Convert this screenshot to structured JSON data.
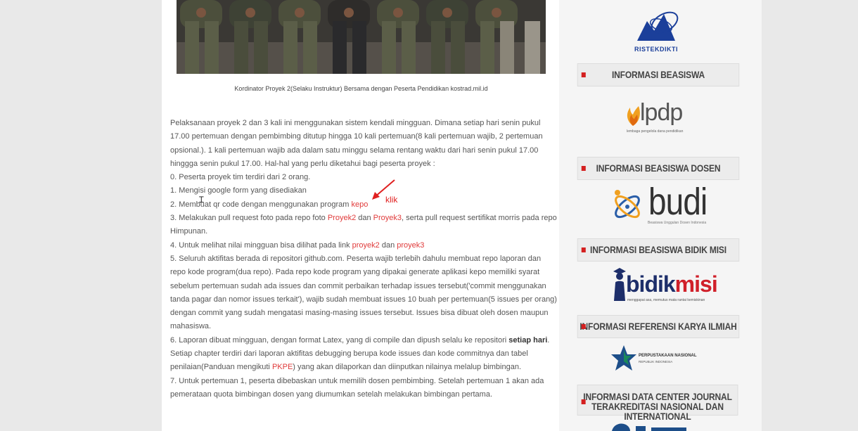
{
  "article": {
    "caption": "Kordinator Proyek 2(Selaku Instruktur) Bersama dengan Peserta Pendidikan kostrad.mil.id",
    "intro": "Pelaksanaan proyek 2 dan 3 kali ini menggunakan sistem kendali mingguan. Dimana setiap hari senin pukul 17.00 pertemuan dengan pembimbing ditutup hingga 10 kali pertemuan(8 kali pertemuan wajib, 2 pertemuan opsional.). 1 kali pertemuan wajib ada dalam satu minggu selama rentang waktu dari hari senin pukul 17.00 hinggga senin pukul 17.00. Hal-hal yang perlu diketahui bagi peserta proyek :",
    "item0": "0. Peserta proyek tim terdiri dari 2 orang.",
    "item1": "1. Mengisi google form yang disediakan",
    "item2_pre": "2. Membuat qr code dengan menggunakan program ",
    "item2_link": "kepo",
    "item3_pre": "3. Melakukan pull request foto pada repo foto ",
    "item3_link1": "Proyek2",
    "item3_mid": " dan ",
    "item3_link2": "Proyek3",
    "item3_post": ", serta pull request sertifikat morris pada repo Himpunan.",
    "item4_pre": "4. Untuk melihat nilai mingguan bisa dilihat pada link ",
    "item4_link1": "proyek2",
    "item4_mid": " dan ",
    "item4_link2": "proyek3",
    "item5": "5. Seluruh aktifitas berada di repositori github.com. Peserta wajib terlebih dahulu membuat repo laporan dan repo kode program(dua repo). Pada repo kode program yang dipakai generate aplikasi kepo memiliki syarat sebelum pertemuan sudah ada issues dan commit perbaikan terhadap issues tersebut('commit menggunakan tanda pagar dan nomor issues terkait'), wajib sudah membuat issues 10 buah per pertemuan(5 issues per orang) dengan commit yang sudah mengatasi masing-masing issues tersebut. Issues bisa dibuat oleh dosen maupun mahasiswa.",
    "item6_pre": "6. Laporan dibuat mingguan, dengan format Latex, yang di compile dan dipush selalu ke repositori ",
    "item6_bold": "setiap hari",
    "item6_mid": ". Setiap chapter terdiri dari laporan aktifitas debugging berupa kode issues dan kode commitnya dan tabel penilaian(Panduan mengikuti ",
    "item6_link": "PKPE",
    "item6_post": ") yang akan dilaporkan dan diinputkan nilainya melalup bimbingan.",
    "item7": "7. Untuk pertemuan 1, peserta dibebaskan untuk memilih dosen pembimbing. Setelah pertemuan 1 akan ada pemerataan quota bimbingan dosen yang diumumkan setelah melakukan bimbingan pertama."
  },
  "annotation": {
    "label": "klik",
    "color": "#e02020"
  },
  "sidebar": {
    "ristek_logo_text": "RISTEKDIKTI",
    "widgets": [
      {
        "title": "INFORMASI BEASISWA"
      },
      {
        "title": "INFORMASI BEASISWA DOSEN"
      },
      {
        "title": "INFORMASI BEASISWA BIDIK MISI"
      },
      {
        "title": "INFORMASI REFERENSI KARYA ILMIAH"
      },
      {
        "title_line1": "INFORMASI DATA CENTER JOURNAL",
        "title_line2": "TERAKREDITASI NASIONAL DAN INTERNATIONAL"
      }
    ],
    "lpdp": {
      "name": "lpdp",
      "sub": "lembaga pengelola dana pendidikan"
    },
    "budi": {
      "name": "budi",
      "sub": "Beasiswa Unggulan Dosen Indonesia"
    },
    "bidikmisi": {
      "name_a": "bidik",
      "name_b": "misi",
      "sub": "menggapai asa, memutus mata rantai kemiskinan"
    },
    "perpusnas": {
      "name": "PERPUSTAKAAN NASIONAL",
      "sub": "REPUBLIK INDONESIA"
    }
  },
  "colors": {
    "link": "#e03a3a",
    "bullet": "#d42020",
    "ristek": "#1b3f9a",
    "lpdp_orange": "#f0a020",
    "bidik_red": "#d0202a",
    "perpus_blue": "#1d4e89",
    "perpus_green": "#1a8a5a"
  }
}
